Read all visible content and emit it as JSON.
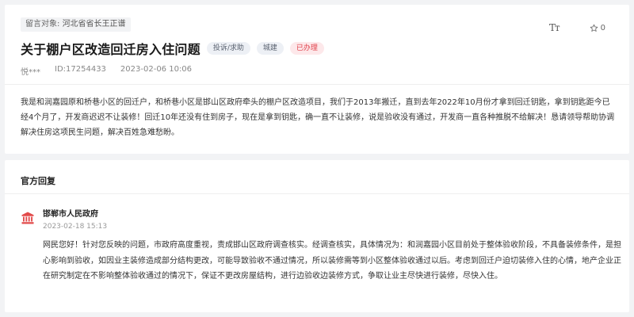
{
  "question": {
    "recipient_label": "留言对象:",
    "recipient_value": "河北省省长王正谱",
    "title": "关于棚户区改造回迁房入住问题",
    "tags": [
      "投诉/求助",
      "城建",
      "已办理"
    ],
    "author": "悦***",
    "id_text": "ID:17254433",
    "datetime": "2023-02-06 10:06",
    "font_tool": "Tт",
    "like_count": "0",
    "content": "我是和润嘉园原和桥巷小区的回迁户，和桥巷小区是邯山区政府牵头的棚户区改造项目，我们于2013年搬迁，直到去年2022年10月份才拿到回迁钥匙，拿到钥匙距今已经4个月了，开发商迟迟不让装修！回迁10年还没有住到房子，现在是拿到钥匙，确一直不让装修，说是验收没有通过，开发商一直各种推脱不给解决！恳请领导帮助协调解决住房这项民生问题，解决百姓急难愁盼。"
  },
  "reply": {
    "section_title": "官方回复",
    "org_name": "邯郸市人民政府",
    "datetime": "2023-02-18 15:13",
    "content": "网民您好！针对您反映的问题，市政府高度重视，责成邯山区政府调查核实。经调查核实，具体情况为：和润嘉园小区目前处于整体验收阶段，不具备装修条件，是担心影响到验收，如因业主装修造成部分结构更改，可能导致验收不通过情况，所以装修需等到小区整体验收通过以后。考虑到回迁户迫切装修入住的心情，地产企业正在研究制定在不影响整体验收通过的情况下，保证不更改房屋结构，进行边验收边装修方式，争取让业主尽快进行装修，尽快入住。"
  },
  "colors": {
    "tag_red_bg": "#fde8ea",
    "tag_red_text": "#e0424b",
    "org_icon": "#e24a4a"
  },
  "icons": {
    "font_size": "font-size-icon",
    "star": "star-icon",
    "org": "government-building-icon"
  }
}
